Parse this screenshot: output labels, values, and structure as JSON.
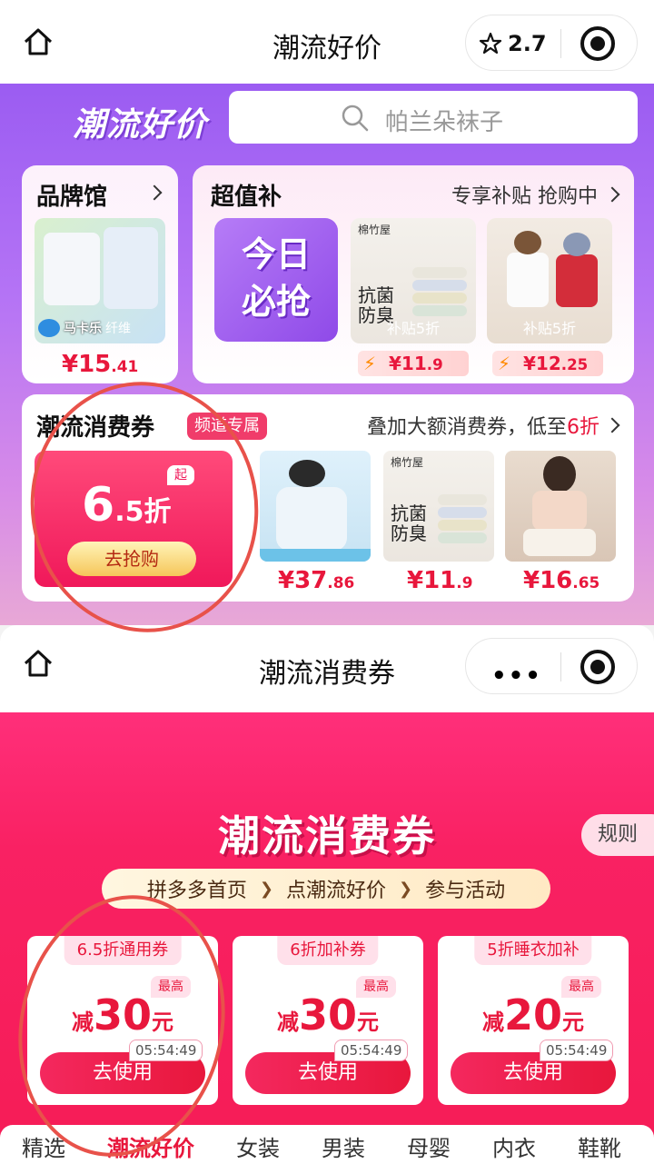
{
  "nav_top": {
    "title": "潮流好价",
    "rating": "2.7"
  },
  "header": {
    "brand_title": "潮流好价",
    "search_placeholder": "帕兰朵袜子"
  },
  "brand_card": {
    "title": "品牌馆",
    "product_label": "马卡乐",
    "product_tag": "纤维",
    "price_main": "¥15",
    "price_dec": ".41"
  },
  "super_card": {
    "title": "超值补",
    "subtitle": "专享补贴 抢购中",
    "today_line1": "今日",
    "today_line2": "必抢",
    "products": [
      {
        "brand": "棉竹屋",
        "label_1": "抗菌",
        "label_2": "防臭",
        "subsidy": "补贴5折",
        "price_main": "¥11",
        "price_dec": ".9"
      },
      {
        "subsidy": "补贴5折",
        "price_main": "¥12",
        "price_dec": ".25"
      }
    ]
  },
  "coupon_card": {
    "title": "潮流消费券",
    "tag": "频道专属",
    "subtitle_pre": "叠加大额消费券，低至",
    "subtitle_hl": "6折",
    "big": {
      "qi": "起",
      "discount_main": "6",
      "discount_dec": ".5折",
      "button": "去抢购"
    },
    "items": [
      {
        "price_main": "¥37",
        "price_dec": ".86"
      },
      {
        "brand": "棉竹屋",
        "label_1": "抗菌",
        "label_2": "防臭",
        "price_main": "¥11",
        "price_dec": ".9"
      },
      {
        "price_main": "¥16",
        "price_dec": ".65"
      }
    ]
  },
  "nav_second": {
    "title": "潮流消费券",
    "dots": "•••"
  },
  "pink": {
    "title": "潮流消费券",
    "rules": "规则",
    "steps": [
      "拼多多首页",
      "点潮流好价",
      "参与活动"
    ],
    "coupons": [
      {
        "tag": "6.5折通用券",
        "max": "最高",
        "prefix": "减",
        "amount": "30",
        "unit": "元",
        "timer": "05:54:49",
        "button": "去使用"
      },
      {
        "tag": "6折加补券",
        "max": "最高",
        "prefix": "减",
        "amount": "30",
        "unit": "元",
        "timer": "05:54:49",
        "button": "去使用"
      },
      {
        "tag": "5折睡衣加补",
        "max": "最高",
        "prefix": "减",
        "amount": "20",
        "unit": "元",
        "timer": "05:54:49",
        "button": "去使用"
      }
    ]
  },
  "bottom_tabs": [
    "精选",
    "潮流好价",
    "女装",
    "男装",
    "母婴",
    "内衣",
    "鞋靴"
  ],
  "colors": {
    "accent": "#e8173c",
    "purple": "#9b5cf2",
    "pink": "#f92163",
    "annotation": "#e8524a"
  }
}
